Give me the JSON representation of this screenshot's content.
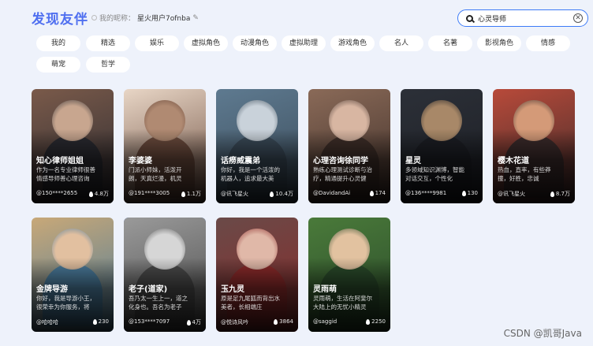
{
  "header": {
    "title": "发现友伴",
    "nickname_label": "我的昵称：",
    "nickname_value": "星火用户7ofnba"
  },
  "search": {
    "value": "心灵导师",
    "placeholder": ""
  },
  "tags": [
    "我的",
    "精选",
    "娱乐",
    "虚拟角色",
    "动漫角色",
    "虚拟助理",
    "游戏角色",
    "名人",
    "名著",
    "影视角色",
    "情感",
    "萌宠",
    "哲学"
  ],
  "cards": [
    {
      "name": "知心律师姐姐",
      "desc": "作为一名专业律师很善",
      "desc2": "情感导师善心理咨询",
      "author": "@150****2655",
      "likes": "4.8万",
      "colors": [
        "#7a5a4a",
        "#c8a68f",
        "#2a2a30"
      ]
    },
    {
      "name": "李婆婆",
      "desc": "门派小师妹，活泼开",
      "desc2": "朗，天真烂漫，机灵",
      "author": "@191****3005",
      "likes": "1.1万",
      "colors": [
        "#e8d6c6",
        "#b08a72",
        "#6a4a3c"
      ]
    },
    {
      "name": "话痨威震弟",
      "desc": "你好，我是一个活泼的",
      "desc2": "机器人，追求最大美",
      "author": "@讯飞星火",
      "likes": "10.4万",
      "colors": [
        "#5e7a90",
        "#c9d2da",
        "#3a4a58"
      ]
    },
    {
      "name": "心理咨询徐同学",
      "desc": "熟练心理测试诊断与治",
      "desc2": "疗，精通提升心灵健",
      "author": "@DavidandAi",
      "likes": "174",
      "colors": [
        "#8a6a58",
        "#d8b6a2",
        "#3e2e28"
      ]
    },
    {
      "name": "星灵",
      "desc": "多领域知识渊博，智能",
      "desc2": "对话交互，个性化",
      "author": "@136****9981",
      "likes": "130",
      "colors": [
        "#2c3038",
        "#a88868",
        "#1c1e24"
      ]
    },
    {
      "name": "樱木花道",
      "desc": "热血，直率，有些莽",
      "desc2": "撞，好胜，忠诚",
      "author": "@讯飞星火",
      "likes": "8.7万",
      "colors": [
        "#b84a3a",
        "#d49a78",
        "#3a2a2a"
      ]
    },
    {
      "name": "金牌导游",
      "desc": "你好，我是导游小王，",
      "desc2": "很荣幸为你服务，将",
      "author": "@哈哈哈",
      "likes": "230",
      "colors": [
        "#c8a878",
        "#e2c0a0",
        "#4a7a9a"
      ]
    },
    {
      "name": "老子(道家)",
      "desc": "吾乃太一生上一，道之",
      "desc2": "化身也。吾名为老子",
      "author": "@153****7097",
      "likes": "4万",
      "colors": [
        "#9a9a9a",
        "#d6d6d6",
        "#4a4a4a"
      ]
    },
    {
      "name": "玉九灵",
      "desc": "原是足九尾狐而背出水",
      "desc2": "美者，长相端庄",
      "author": "@悦诗风吟",
      "likes": "3864",
      "colors": [
        "#6a4a48",
        "#e0b8a8",
        "#8a2a2a"
      ]
    },
    {
      "name": "灵雨萌",
      "desc": "灵雨萌，生活在阿斐尔",
      "desc2": "大陆上的无忧小精灵",
      "author": "@saggid",
      "likes": "2250",
      "colors": [
        "#4a7a3a",
        "#e2c2a0",
        "#2a4a2a"
      ]
    }
  ],
  "watermark": "CSDN @凯哥Java"
}
